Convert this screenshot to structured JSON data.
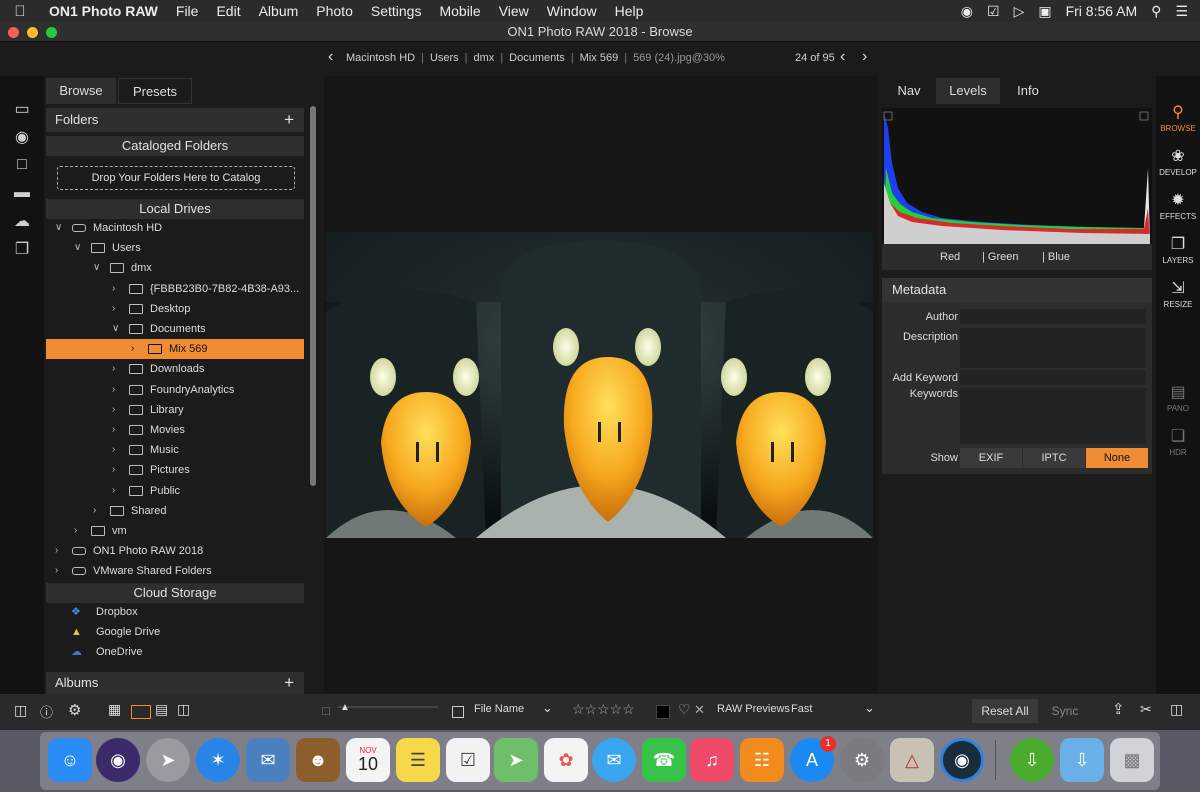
{
  "menubar": {
    "app_name": "ON1 Photo RAW",
    "items": [
      "File",
      "Edit",
      "Album",
      "Photo",
      "Settings",
      "Mobile",
      "View",
      "Window",
      "Help"
    ],
    "clock": "Fri 8:56 AM"
  },
  "window": {
    "title": "ON1 Photo RAW 2018 - Browse"
  },
  "path": {
    "crumbs": [
      "Macintosh HD",
      "Users",
      "dmx",
      "Documents",
      "Mix 569"
    ],
    "file": "569 (24).jpg@30%",
    "position": "24 of 95"
  },
  "left_tabs": {
    "browse": "Browse",
    "presets": "Presets"
  },
  "folders": {
    "title": "Folders",
    "add": "+",
    "cataloged_title": "Cataloged Folders",
    "drop_zone": "Drop Your Folders Here to Catalog",
    "local_title": "Local Drives",
    "tree": [
      {
        "label": "Macintosh HD",
        "depth": 0,
        "open": true,
        "type": "drive"
      },
      {
        "label": "Users",
        "depth": 1,
        "open": true,
        "type": "folder"
      },
      {
        "label": "dmx",
        "depth": 2,
        "open": true,
        "type": "folder"
      },
      {
        "label": "{FBBB23B0-7B82-4B38-A93...",
        "depth": 3,
        "open": false,
        "type": "folder"
      },
      {
        "label": "Desktop",
        "depth": 3,
        "open": false,
        "type": "folder"
      },
      {
        "label": "Documents",
        "depth": 3,
        "open": true,
        "type": "folder"
      },
      {
        "label": "Mix 569",
        "depth": 4,
        "open": false,
        "type": "folder",
        "selected": true
      },
      {
        "label": "Downloads",
        "depth": 3,
        "open": false,
        "type": "folder"
      },
      {
        "label": "FoundryAnalytics",
        "depth": 3,
        "open": false,
        "type": "folder"
      },
      {
        "label": "Library",
        "depth": 3,
        "open": false,
        "type": "folder"
      },
      {
        "label": "Movies",
        "depth": 3,
        "open": false,
        "type": "folder"
      },
      {
        "label": "Music",
        "depth": 3,
        "open": false,
        "type": "folder"
      },
      {
        "label": "Pictures",
        "depth": 3,
        "open": false,
        "type": "folder"
      },
      {
        "label": "Public",
        "depth": 3,
        "open": false,
        "type": "folder"
      },
      {
        "label": "Shared",
        "depth": 2,
        "open": false,
        "type": "folder"
      },
      {
        "label": "vm",
        "depth": 1,
        "open": false,
        "type": "folder"
      },
      {
        "label": "ON1 Photo RAW 2018",
        "depth": 0,
        "open": false,
        "type": "drive"
      },
      {
        "label": "VMware Shared Folders",
        "depth": 0,
        "open": false,
        "type": "drive"
      }
    ],
    "cloud_title": "Cloud Storage",
    "cloud": [
      {
        "label": "Dropbox",
        "icon": "dropbox-icon",
        "color": "#3d8cf0"
      },
      {
        "label": "Google Drive",
        "icon": "google-drive-icon",
        "color": "#f2c233"
      },
      {
        "label": "OneDrive",
        "icon": "onedrive-icon",
        "color": "#3b78d8"
      }
    ]
  },
  "albums": {
    "title": "Albums",
    "add": "+"
  },
  "right_tabs": {
    "nav": "Nav",
    "levels": "Levels",
    "info": "Info"
  },
  "histogram": {
    "labels": [
      "Red",
      "Green",
      "Blue"
    ]
  },
  "metadata": {
    "title": "Metadata",
    "author_label": "Author",
    "description_label": "Description",
    "add_keyword_label": "Add Keyword",
    "keywords_label": "Keywords",
    "show_label": "Show",
    "buttons": [
      "EXIF",
      "IPTC",
      "None"
    ],
    "selected": "None"
  },
  "modules": [
    {
      "label": "BROWSE",
      "icon": "browse-icon",
      "state": "active"
    },
    {
      "label": "DEVELOP",
      "icon": "develop-icon",
      "state": "normal"
    },
    {
      "label": "EFFECTS",
      "icon": "effects-icon",
      "state": "normal"
    },
    {
      "label": "LAYERS",
      "icon": "layers-icon",
      "state": "normal"
    },
    {
      "label": "RESIZE",
      "icon": "resize-icon",
      "state": "normal"
    },
    {
      "label": "PANO",
      "icon": "pano-icon",
      "state": "dim"
    },
    {
      "label": "HDR",
      "icon": "hdr-icon",
      "state": "dim"
    }
  ],
  "bottombar": {
    "sort_label": "File Name",
    "previews_label": "RAW Previews",
    "previews_value": "Fast",
    "reset_all": "Reset All",
    "sync": "Sync"
  },
  "dock": {
    "badge": "1",
    "calendar_month": "NOV",
    "calendar_day": "10",
    "apps": [
      "finder",
      "siri",
      "launchpad",
      "safari",
      "mail",
      "contacts",
      "calendar",
      "notes",
      "reminders",
      "maps",
      "photos",
      "messages",
      "facetime",
      "itunes",
      "ibooks",
      "app-store",
      "system-preferences",
      "instruments",
      "on1-photo-raw",
      "download-manager",
      "downloads-folder",
      "trash"
    ]
  },
  "colors": {
    "accent": "#f08c34",
    "panel": "#1b1b1b",
    "section": "#2e2e2e"
  }
}
